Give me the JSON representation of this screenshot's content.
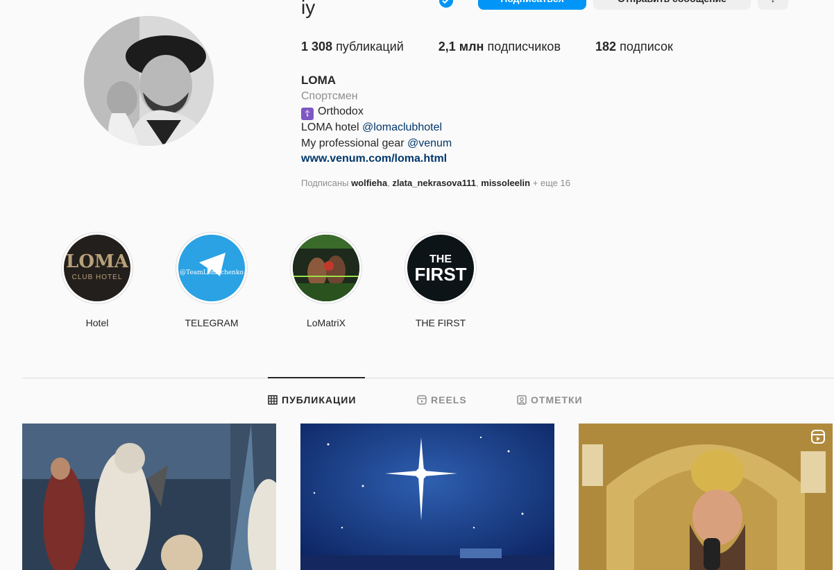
{
  "profile": {
    "username": "iy",
    "buttons": {
      "follow": "Подписаться",
      "message": "Отправить сообщение",
      "more": "↓"
    },
    "stats": {
      "posts_count": "1 308",
      "posts_label": "публикаций",
      "followers_count": "2,1 млн",
      "followers_label": "подписчиков",
      "following_count": "182",
      "following_label": "подписок"
    },
    "bio": {
      "name": "LOMA",
      "category": "Спортсмен",
      "line1": "Orthodox",
      "line2_prefix": "LOMA hotel ",
      "line2_mention": "@lomaclubhotel",
      "line3_prefix": "My professional gear ",
      "line3_mention": "@venum",
      "website": "www.venum.com/loma.html"
    },
    "followed_by": {
      "prefix": "Подписаны",
      "user1": "wolfieha",
      "user2": "zlata_nekrasova111",
      "user3": "missoleelin",
      "more": "+ еще 16"
    }
  },
  "highlights": [
    {
      "label": "Hotel",
      "logo_line1": "LOMA",
      "logo_line2": "CLUB HOTEL"
    },
    {
      "label": "TELEGRAM",
      "caption": "@TeamLomachenko"
    },
    {
      "label": "LoMatriX"
    },
    {
      "label": "THE FIRST",
      "logo_line1": "THE",
      "logo_line2": "FIRST"
    }
  ],
  "tabs": [
    {
      "label": "ПУБЛИКАЦИИ",
      "icon": "grid-icon"
    },
    {
      "label": "REELS",
      "icon": "reels-icon"
    },
    {
      "label": "ОТМЕТКИ",
      "icon": "tagged-icon"
    }
  ],
  "colors": {
    "accent": "#0095f6",
    "link": "#00376b",
    "muted": "#8e8e8e"
  }
}
